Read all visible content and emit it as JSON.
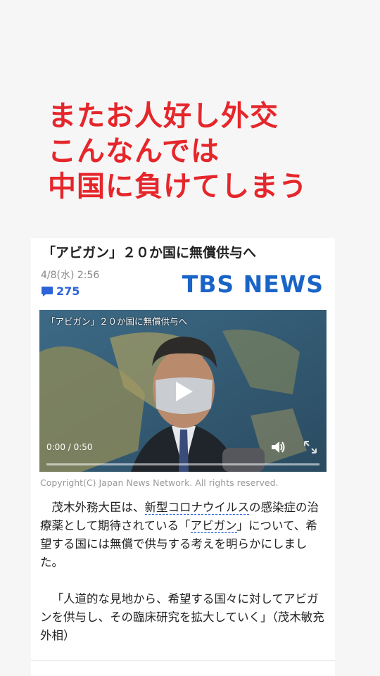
{
  "overlay": {
    "lines": [
      "またお人好し外交",
      "こんなんでは",
      "中国に負けてしまう"
    ]
  },
  "article": {
    "title": "「アビガン」２０か国に無償供与へ",
    "date": "4/8(水) 2:56",
    "comment_count": "275",
    "source_logo": "TBS NEWS",
    "video": {
      "title": "「アビガン」２０か国に無償供与へ",
      "time": "0:00 / 0:50",
      "progress": 0
    },
    "copyright": "Copyright(C) Japan News Network. All rights reserved.",
    "p1": {
      "a": "茂木外務大臣は、",
      "link1": "新型コロナウイルス",
      "b": "の感染症の治療薬として期待されている「",
      "link2": "アビガン",
      "c": "」について、希望する国には無償で供与する考えを明らかにしました。"
    },
    "quote": "「人道的な見地から、希望する国々に対してアビガンを供与し、その臨床研究を拡大していく」（茂木敏充 外相）"
  },
  "colors": {
    "headline": "#e5262b",
    "accent": "#2b63d9",
    "logo": "#1a64c8"
  },
  "icons": [
    "comment-icon",
    "play-icon",
    "volume-icon",
    "fullscreen-icon"
  ]
}
